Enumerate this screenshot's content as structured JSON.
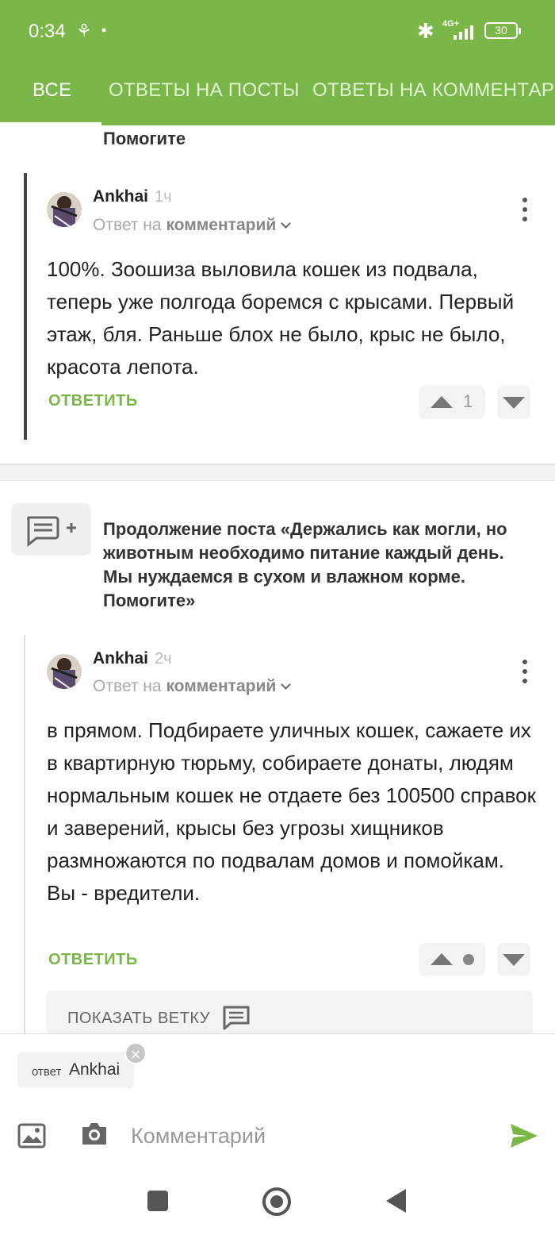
{
  "status_bar": {
    "time": "0:34",
    "network": "4G+",
    "battery": "30"
  },
  "tabs": [
    {
      "label": "ВСЕ",
      "active": true
    },
    {
      "label": "ОТВЕТЫ НА ПОСТЫ",
      "active": false
    },
    {
      "label": "ОТВЕТЫ НА КОММЕНТАРИИ",
      "active": false
    }
  ],
  "fragment_title": "Помогите",
  "comments": [
    {
      "author": "Ankhai",
      "time": "1ч",
      "reply_prefix": "Ответ на",
      "reply_target": "комментарий",
      "text": "100%. Зоошиза выловила кошек из подвала, теперь уже полгода боремся с крысами. Первый этаж, бля. Раньше блох не было, крыс не было, красота лепота.",
      "reply_label": "ОТВЕТИТЬ",
      "rating": "1"
    },
    {
      "author": "Ankhai",
      "time": "2ч",
      "reply_prefix": "Ответ на",
      "reply_target": "комментарий",
      "text": "в прямом. Подбираете уличных кошек, сажаете их в квартирную тюрьму, собираете донаты, людям нормальным кошек не отдаете без 100500 справок и заверений, крысы без угрозы хищников размножаются по подвалам домов и помойкам. Вы - вредители.",
      "reply_label": "ОТВЕТИТЬ",
      "rating": ""
    }
  ],
  "post_reference": {
    "title": "Продолжение поста «Держались как могли, но животным необходимо питание каждый день. Мы нуждаемся в сухом и влажном корме. Помогите»"
  },
  "show_thread_label": "ПОКАЗАТЬ ВЕТКУ",
  "composer": {
    "reply_chip_prefix": "ответ",
    "reply_chip_name": "Ankhai",
    "placeholder": "Комментарий"
  },
  "colors": {
    "brand_green": "#7ab648",
    "vote_gray": "#777777"
  }
}
